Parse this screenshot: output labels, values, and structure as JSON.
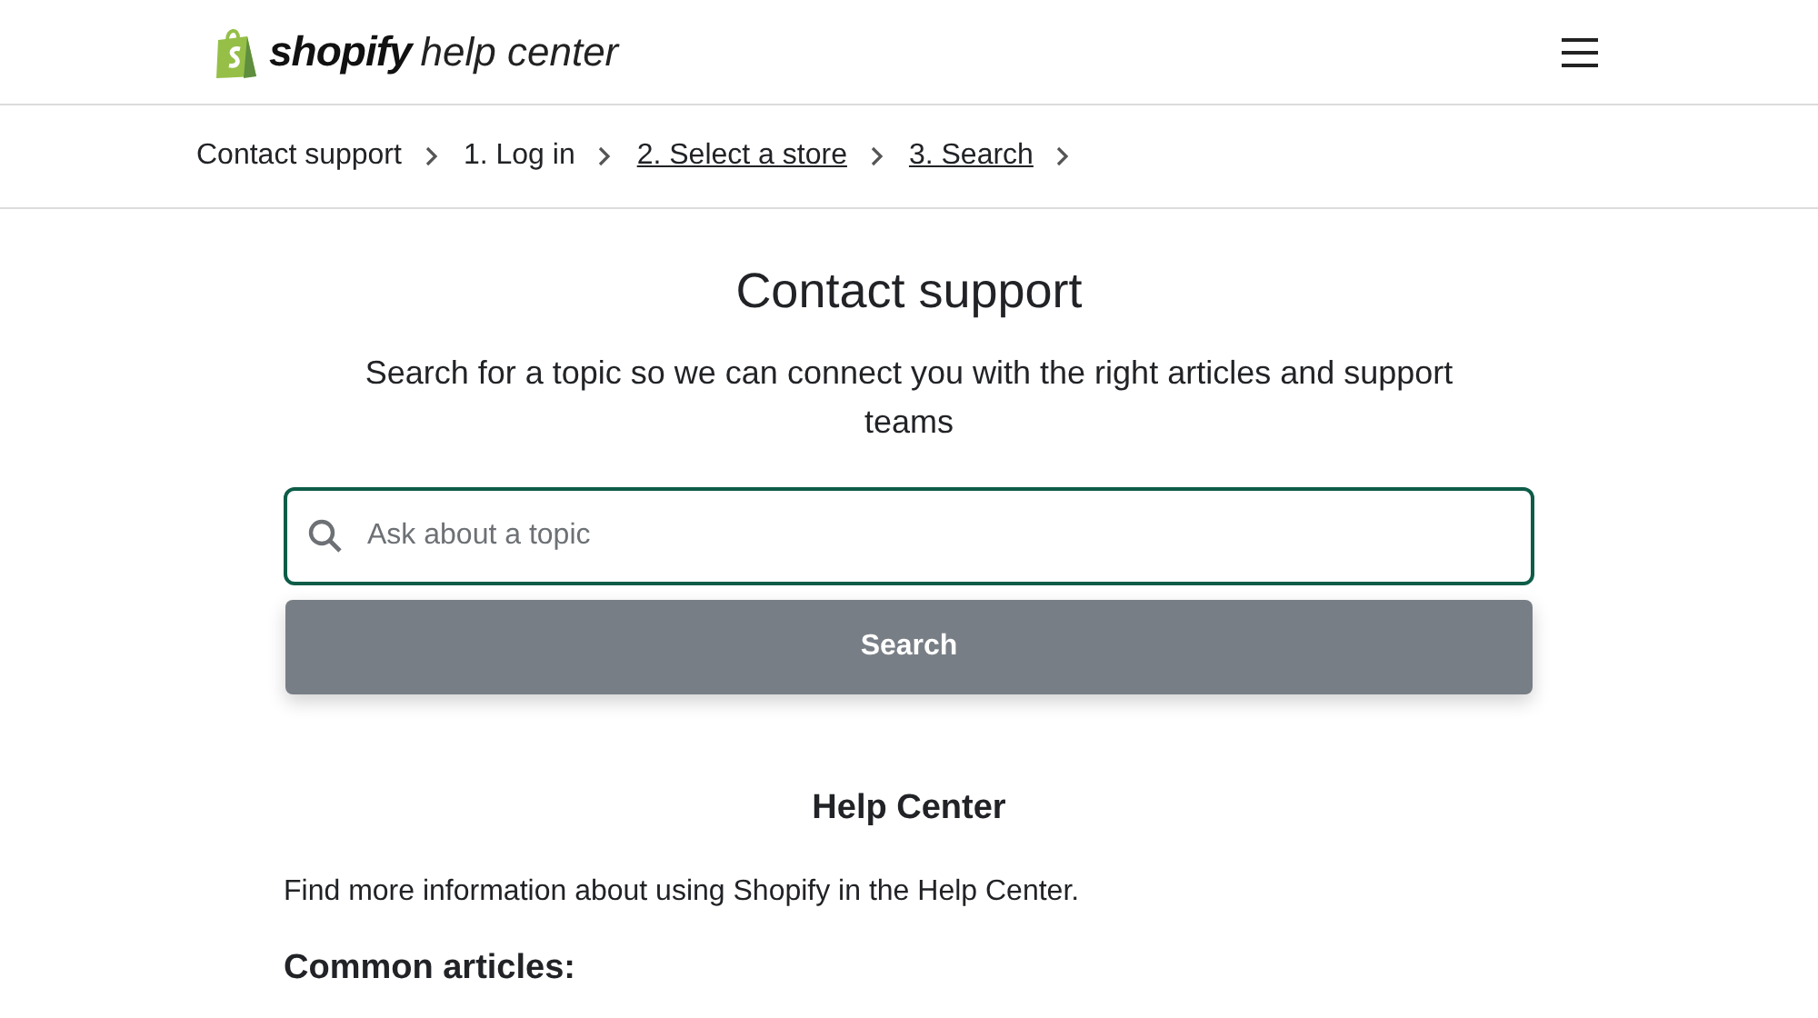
{
  "header": {
    "brand": "shopify",
    "product": "help center"
  },
  "breadcrumbs": [
    {
      "label": "Contact support",
      "kind": "text"
    },
    {
      "label": "1. Log in",
      "kind": "text"
    },
    {
      "label": "2. Select a store",
      "kind": "link"
    },
    {
      "label": "3. Search",
      "kind": "link"
    }
  ],
  "title": "Contact support",
  "subtitle": "Search for a topic so we can connect you with the right articles and support teams",
  "search": {
    "placeholder": "Ask about a topic",
    "button": "Search"
  },
  "help_center": {
    "heading": "Help Center",
    "text": "Find more information about using Shopify in the Help Center.",
    "list_heading": "Common articles:"
  }
}
